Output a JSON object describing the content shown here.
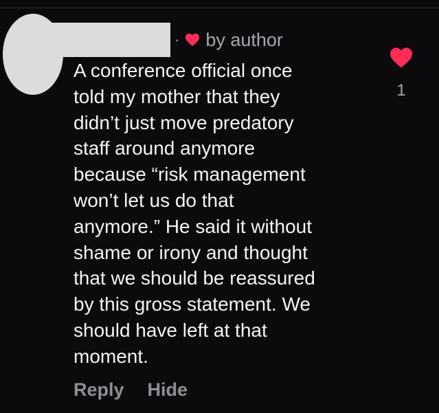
{
  "comment": {
    "meta_separator": "·",
    "author_badge": "by author",
    "body": "A conference official once\ntold my mother that they\ndidn’t just move predatory\nstaff around anymore\nbecause “risk management\nwon’t let us do that\nanymore.” He said it without\nshame or irony and thought\nthat we should be reassured\nby this gross statement. We\nshould have left at that\nmoment.",
    "like_count": "1",
    "actions": {
      "reply": "Reply",
      "hide": "Hide"
    }
  },
  "icons": {
    "author_heart": "heart-icon",
    "like_heart": "heart-icon"
  },
  "colors": {
    "background": "#0b0b0d",
    "heart": "#ff2d55",
    "text": "#f4f4f4",
    "muted": "#a7a7ad",
    "redaction": "#dcdcdc"
  }
}
